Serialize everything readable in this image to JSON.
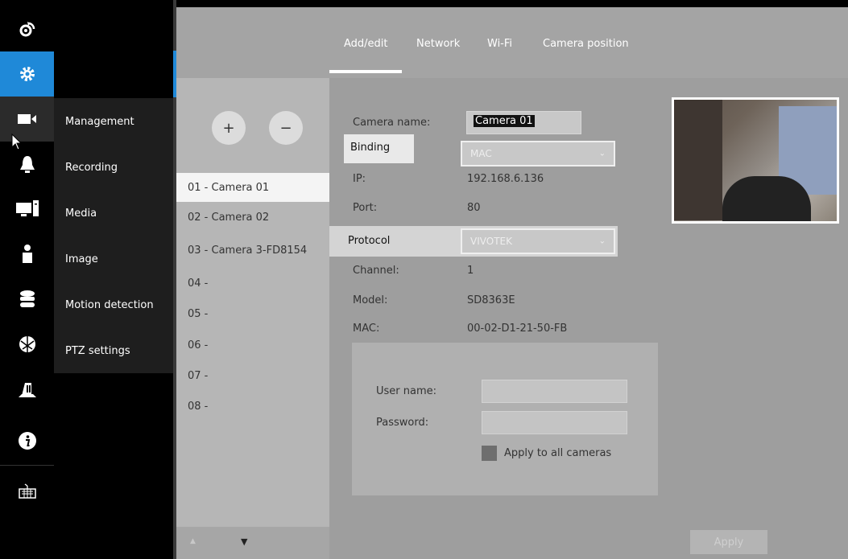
{
  "rail": {
    "items": [
      {
        "icon": "logout-icon"
      },
      {
        "icon": "gear-icon",
        "active": true
      },
      {
        "icon": "camera-icon"
      },
      {
        "icon": "bell-icon"
      },
      {
        "icon": "monitor-icon"
      },
      {
        "icon": "user-icon"
      },
      {
        "icon": "storage-icon"
      },
      {
        "icon": "network-globe-icon"
      },
      {
        "icon": "building-icon"
      },
      {
        "icon": "info-icon"
      },
      {
        "icon": "keyboard-icon"
      }
    ]
  },
  "submenu": {
    "items": [
      {
        "label": "Management"
      },
      {
        "label": "Recording"
      },
      {
        "label": "Media"
      },
      {
        "label": "Image"
      },
      {
        "label": "Motion detection"
      },
      {
        "label": "PTZ settings"
      }
    ]
  },
  "tabs": [
    {
      "label": "Add/edit",
      "active": true
    },
    {
      "label": "Network"
    },
    {
      "label": "Wi-Fi"
    },
    {
      "label": "Camera position"
    }
  ],
  "camlist": {
    "add_label": "+",
    "remove_label": "−",
    "cameras": [
      {
        "label": "01 - Camera 01",
        "selected": true
      },
      {
        "label": "02 - Camera 02"
      },
      {
        "label": "03 - Camera 3-FD8154"
      },
      {
        "label": "04 -"
      },
      {
        "label": "05 -"
      },
      {
        "label": "06 -"
      },
      {
        "label": "07 -"
      },
      {
        "label": "08 -"
      }
    ],
    "scroll_up": "▲",
    "scroll_down": "▼"
  },
  "form": {
    "camera_name_label": "Camera name:",
    "camera_name_value": "Camera 01",
    "binding_label": "Binding",
    "binding_value": "MAC",
    "ip_label": "IP:",
    "ip_value": "192.168.6.136",
    "port_label": "Port:",
    "port_value": "80",
    "protocol_label": "Protocol",
    "protocol_value": "VIVOTEK",
    "channel_label": "Channel:",
    "channel_value": "1",
    "model_label": "Model:",
    "model_value": "SD8363E",
    "mac_label": "MAC:",
    "mac_value": "00-02-D1-21-50-FB",
    "username_label": "User name:",
    "password_label": "Password:",
    "apply_all_label": "Apply to all cameras"
  },
  "apply_label": "Apply",
  "colors": {
    "accent": "#1f89d8",
    "rail_bg": "#000000",
    "main_bg": "#9e9e9e"
  }
}
